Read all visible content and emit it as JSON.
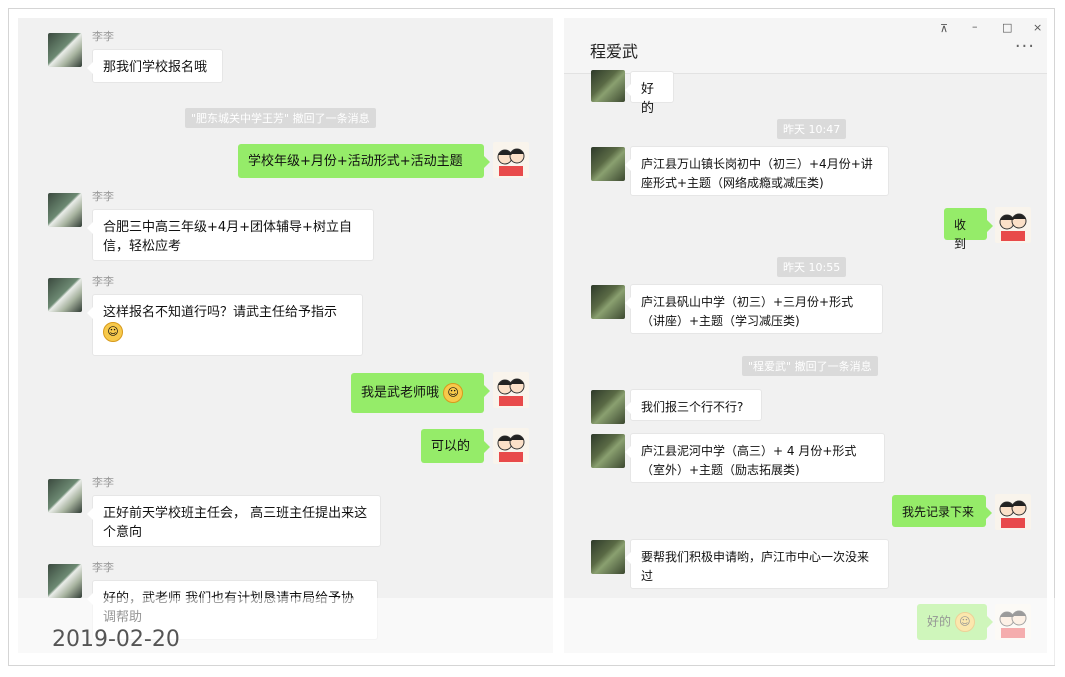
{
  "date_stamp": "2019-02-20",
  "left_chat": {
    "messages": [
      {
        "sender": "李李",
        "text": "那我们学校报名哦"
      },
      {
        "system": "\"肥东城关中学王芳\" 撤回了一条消息"
      },
      {
        "me": "学校年级+月份+活动形式+活动主题"
      },
      {
        "sender": "李李",
        "text": "合肥三中高三年级+4月+团体辅导+树立自信，轻松应考"
      },
      {
        "sender": "李李",
        "text": "这样报名不知道行吗？请武主任给予指示"
      },
      {
        "me": "我是武老师哦"
      },
      {
        "me": "可以的"
      },
      {
        "sender": "李李",
        "text": "正好前天学校班主任会， 高三班主任提出来这个意向"
      },
      {
        "sender": "李李",
        "text": "好的，武老师 我们也有计划恳请市局给予协调帮助"
      }
    ]
  },
  "right_chat": {
    "title": "程爱武",
    "more": "···",
    "window_controls": [
      "⊼",
      "–",
      "□",
      "×"
    ],
    "messages": [
      {
        "text": "好的"
      },
      {
        "time": "昨天 10:47"
      },
      {
        "text": "庐江县万山镇长岗初中（初三）+4月份+讲座形式+主题（网络成瘾或减压类)"
      },
      {
        "me": "收到"
      },
      {
        "time": "昨天 10:55"
      },
      {
        "text": "庐江县矾山中学（初三）+三月份+形式（讲座）+主题（学习减压类)"
      },
      {
        "system": "\"程爱武\" 撤回了一条消息"
      },
      {
        "text": "我们报三个行不行?"
      },
      {
        "text": "庐江县泥河中学（高三）+ 4 月份+形式（室外）+主题（励志拓展类)"
      },
      {
        "me": "我先记录下来"
      },
      {
        "text": "要帮我们积极申请哟，庐江市中心一次没来过"
      },
      {
        "me": "好的"
      }
    ]
  },
  "colors": {
    "my_bubble": "#95ec69",
    "panel_bg": "#f1f1f1"
  },
  "icons": [
    "face-grin-icon",
    "face-think-icon",
    "face-smile-icon"
  ]
}
